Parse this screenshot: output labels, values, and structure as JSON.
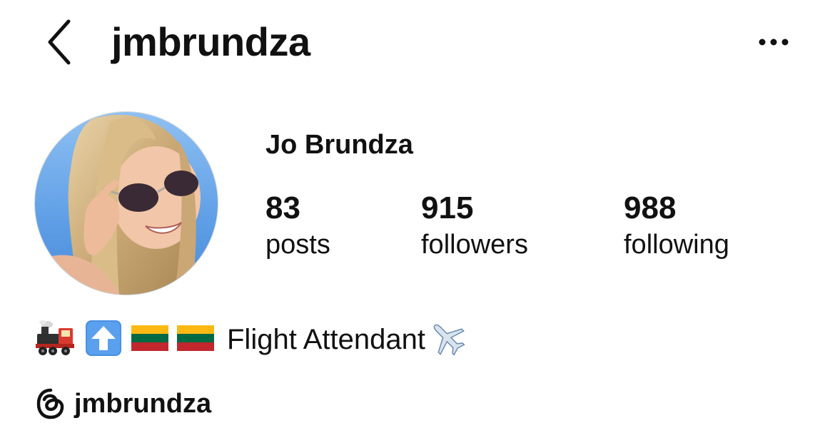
{
  "header": {
    "username": "jmbrundza",
    "back_icon": "chevron-left-icon",
    "more_icon": "more-horizontal-icon"
  },
  "profile": {
    "display_name": "Jo Brundza",
    "avatar": "profile-photo",
    "stats": [
      {
        "value": "83",
        "label": "posts"
      },
      {
        "value": "915",
        "label": "followers"
      },
      {
        "value": "988",
        "label": "following"
      }
    ],
    "bio": {
      "emojis": [
        "steam-locomotive-icon",
        "up-arrow-icon",
        "lithuania-flag-icon",
        "lithuania-flag-icon"
      ],
      "text": "Flight Attendant",
      "trailing_emoji": "airplane-icon"
    },
    "threads": {
      "icon": "threads-icon",
      "handle": "jmbrundza"
    }
  },
  "colors": {
    "text": "#111111",
    "flag_yellow": "#FDB913",
    "flag_green": "#006A44",
    "flag_red": "#C1272D",
    "sky": "#6AA8E8"
  }
}
